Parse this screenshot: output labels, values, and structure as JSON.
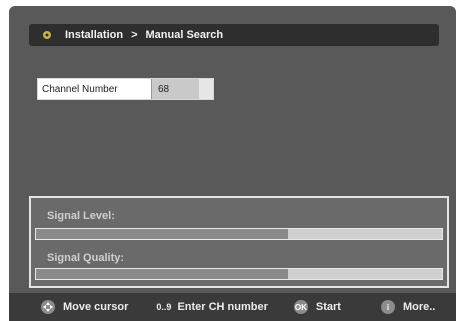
{
  "header": {
    "breadcrumb_root": "Installation",
    "breadcrumb_sep": ">",
    "breadcrumb_current": "Manual Search",
    "icon": "satellite-dish-icon"
  },
  "form": {
    "channel_label": "Channel Number",
    "channel_value": "68"
  },
  "signal": {
    "level_label": "Signal Level:",
    "level_fraction": 0.62,
    "quality_label": "Signal Quality:",
    "quality_fraction": 0.62
  },
  "footer": {
    "move_cursor": "Move cursor",
    "enter_ch": "Enter CH number",
    "enter_ch_icon_text": "0..9",
    "start": "Start",
    "start_icon_text": "OK",
    "more": "More..",
    "more_icon_text": "i"
  },
  "colors": {
    "background": "#595959",
    "title_bar": "#2e2e2e",
    "footer": "#3a3a3a",
    "bar_track": "#d0d0d0",
    "bar_fill": "#8a8a8a"
  }
}
